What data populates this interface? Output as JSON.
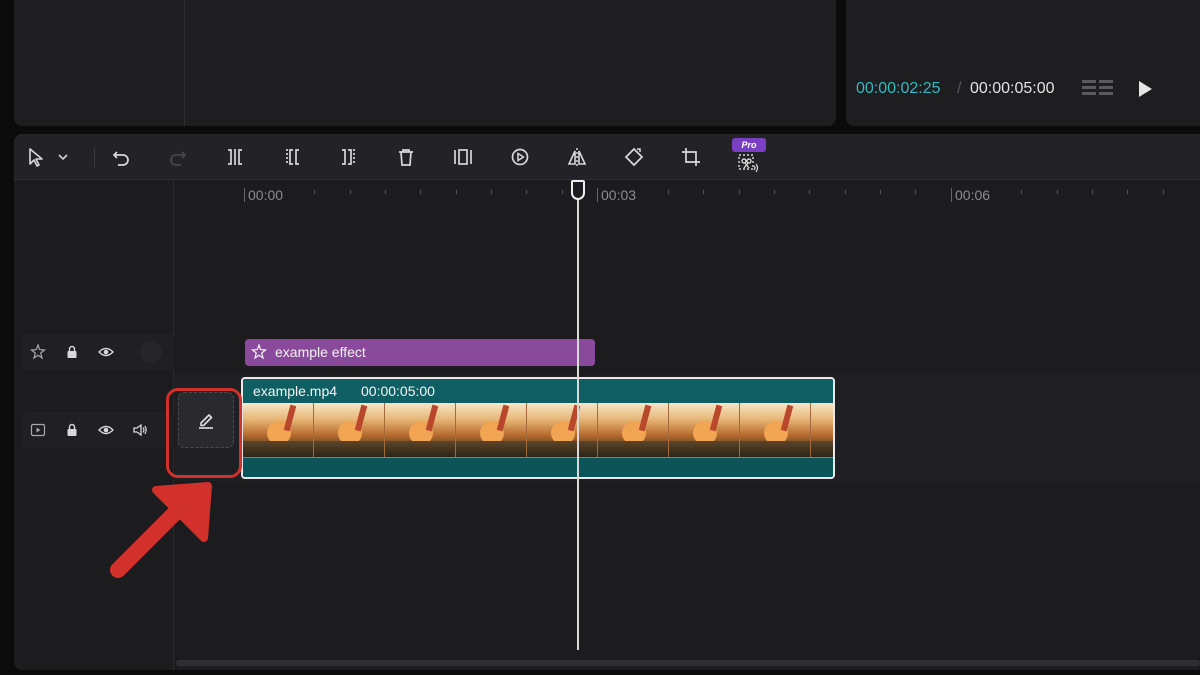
{
  "player": {
    "current_time": "00:00:02:25",
    "separator": "/",
    "total_time": "00:00:05:00",
    "icons": [
      "aspect-ratio-icon",
      "play-icon"
    ]
  },
  "toolbar": {
    "tools": [
      "select-pointer-icon",
      "chevron-down-icon",
      "undo-icon",
      "redo-icon",
      "split-icon",
      "split-left-icon",
      "split-right-icon",
      "delete-icon",
      "freeze-icon",
      "reverse-icon",
      "mirror-icon",
      "rotate-icon",
      "crop-icon",
      "remove-background-icon"
    ],
    "pro_badge": "Pro"
  },
  "ruler": {
    "labels": [
      "00:00",
      "00:03",
      "00:06"
    ]
  },
  "tracks": {
    "effect_track": {
      "icons": [
        "effect-icon",
        "lock-icon",
        "eye-icon"
      ]
    },
    "video_track": {
      "icons": [
        "video-icon",
        "lock-icon",
        "eye-icon",
        "audio-icon"
      ]
    }
  },
  "effect_clip": {
    "label": "example effect"
  },
  "video_clip": {
    "name": "example.mp4",
    "duration": "00:00:05:00",
    "frame_count": 8
  },
  "annotation": {
    "highlight_color": "#d2302a"
  },
  "colors": {
    "accent_time": "#35b8c3",
    "effect_clip": "#8a4a9b",
    "video_clip": "#0d5b60",
    "pro_badge": "#7b3fc4"
  }
}
